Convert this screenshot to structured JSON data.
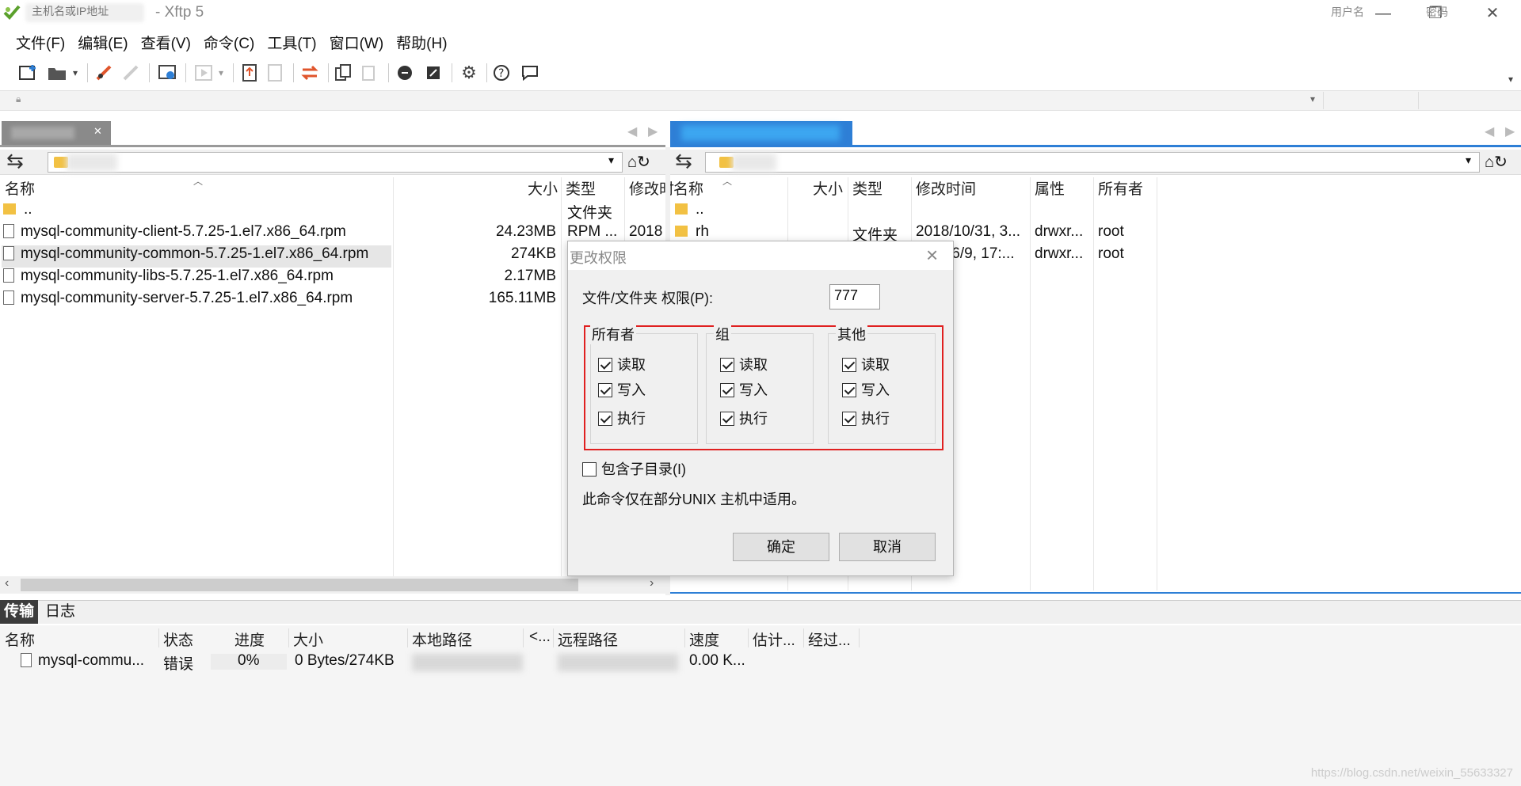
{
  "window": {
    "title": " - Xftp 5",
    "minimize": "—",
    "restore": "❐",
    "close": "✕"
  },
  "menu": [
    "文件(F)",
    "编辑(E)",
    "查看(V)",
    "命令(C)",
    "工具(T)",
    "窗口(W)",
    "帮助(H)"
  ],
  "address": {
    "host_placeholder": "主机名或IP地址",
    "user_placeholder": "用户名",
    "pass_placeholder": "密码"
  },
  "left_pane": {
    "columns": [
      "名称",
      "大小",
      "类型",
      "修改时"
    ],
    "files": [
      {
        "name": "..",
        "size": "",
        "type": "文件夹",
        "modified": "",
        "icon": "folder"
      },
      {
        "name": "mysql-community-client-5.7.25-1.el7.x86_64.rpm",
        "size": "24.23MB",
        "type": "RPM ...",
        "modified": "2018",
        "icon": "file"
      },
      {
        "name": "mysql-community-common-5.7.25-1.el7.x86_64.rpm",
        "size": "274KB",
        "type": "",
        "modified": "",
        "icon": "file"
      },
      {
        "name": "mysql-community-libs-5.7.25-1.el7.x86_64.rpm",
        "size": "2.17MB",
        "type": "",
        "modified": "",
        "icon": "file"
      },
      {
        "name": "mysql-community-server-5.7.25-1.el7.x86_64.rpm",
        "size": "165.11MB",
        "type": "",
        "modified": "",
        "icon": "file"
      }
    ]
  },
  "right_pane": {
    "columns": [
      "名称",
      "大小",
      "类型",
      "修改时间",
      "属性",
      "所有者"
    ],
    "files": [
      {
        "name": "..",
        "size": "",
        "type": "",
        "modified": "",
        "attr": "",
        "owner": ""
      },
      {
        "name": "rh",
        "size": "",
        "type": "文件夹",
        "modified": "2018/10/31, 3...",
        "attr": "drwxr...",
        "owner": "root"
      },
      {
        "name": "",
        "size": "",
        "type": "",
        "modified": "/6/9, 17:...",
        "attr": "drwxr...",
        "owner": "root"
      }
    ]
  },
  "dialog": {
    "title": "更改权限",
    "perm_label": "文件/文件夹 权限(P):",
    "perm_value": "777",
    "groups": [
      {
        "title": "所有者",
        "items": [
          {
            "label": "读取",
            "checked": true
          },
          {
            "label": "写入",
            "checked": true
          },
          {
            "label": "执行",
            "checked": true
          }
        ]
      },
      {
        "title": "组",
        "items": [
          {
            "label": "读取",
            "checked": true
          },
          {
            "label": "写入",
            "checked": true
          },
          {
            "label": "执行",
            "checked": true
          }
        ]
      },
      {
        "title": "其他",
        "items": [
          {
            "label": "读取",
            "checked": true
          },
          {
            "label": "写入",
            "checked": true
          },
          {
            "label": "执行",
            "checked": true
          }
        ]
      }
    ],
    "subdir_label": "包含子目录(I)",
    "subdir_checked": false,
    "note": "此命令仅在部分UNIX 主机中适用。",
    "ok": "确定",
    "cancel": "取消"
  },
  "transfer": {
    "tabs": [
      "传输",
      "日志"
    ],
    "columns": [
      "名称",
      "状态",
      "进度",
      "大小",
      "本地路径",
      "<...",
      "远程路径",
      "速度",
      "估计...",
      "经过..."
    ],
    "row": {
      "name": "mysql-commu...",
      "status": "错误",
      "progress": "0%",
      "size": "0 Bytes/274KB",
      "speed": "0.00 K..."
    }
  },
  "watermark": "https://blog.csdn.net/weixin_55633327",
  "colors": {
    "accent": "#2e7fd6",
    "highlight_border": "#e02020"
  }
}
